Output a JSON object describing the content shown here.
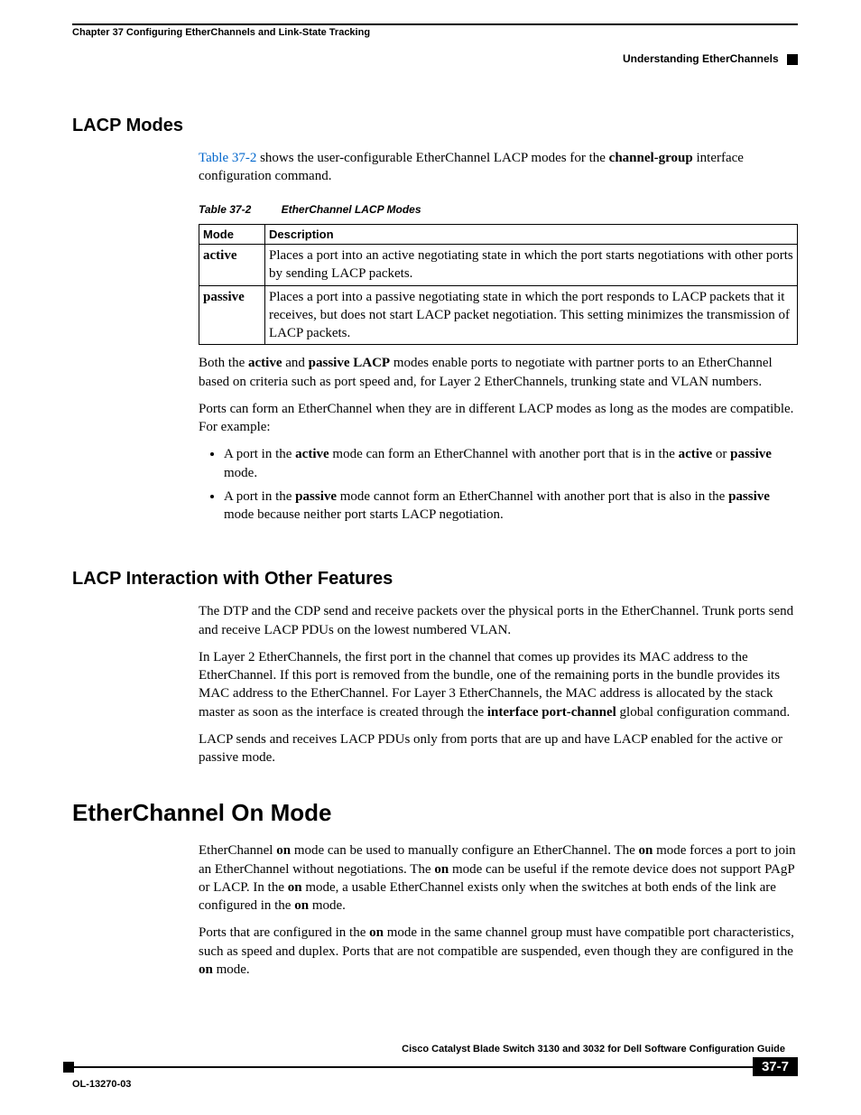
{
  "header": {
    "chapter": "Chapter 37      Configuring EtherChannels and Link-State Tracking",
    "section": "Understanding EtherChannels"
  },
  "s1": {
    "heading": "LACP Modes",
    "intro_link": "Table 37-2",
    "intro_a": " shows the user-configurable EtherChannel LACP modes for the ",
    "intro_b": "channel-group",
    "intro_c": " interface configuration command.",
    "table_caption_num": "Table 37-2",
    "table_caption_title": "EtherChannel LACP Modes",
    "th1": "Mode",
    "th2": "Description",
    "row1_mode": "active",
    "row1_desc": "Places a port into an active negotiating state in which the port starts negotiations with other ports by sending LACP packets.",
    "row2_mode": "passive",
    "row2_desc": "Places a port into a passive negotiating state in which the port responds to LACP packets that it receives, but does not start LACP packet negotiation. This setting minimizes the transmission of LACP packets.",
    "p2_a": "Both the ",
    "p2_b": "active",
    "p2_c": " and ",
    "p2_d": "passive LACP",
    "p2_e": " modes enable ports to negotiate with partner ports to an EtherChannel based on criteria such as port speed and, for Layer 2 EtherChannels, trunking state and VLAN numbers.",
    "p3": "Ports can form an EtherChannel when they are in different LACP modes as long as the modes are compatible. For example:",
    "b1_a": "A port in the ",
    "b1_b": "active",
    "b1_c": " mode can form an EtherChannel with another port that is in the ",
    "b1_d": "active",
    "b1_e": " or ",
    "b1_f": "passive",
    "b1_g": " mode.",
    "b2_a": "A port in the ",
    "b2_b": "passive",
    "b2_c": " mode cannot form an EtherChannel with another port that is also in the ",
    "b2_d": "passive",
    "b2_e": " mode because neither port starts LACP negotiation."
  },
  "s2": {
    "heading": "LACP Interaction with Other Features",
    "p1": "The DTP and the CDP send and receive packets over the physical ports in the EtherChannel. Trunk ports send and receive LACP PDUs on the lowest numbered VLAN.",
    "p2_a": "In Layer 2 EtherChannels, the first port in the channel that comes up provides its MAC address to the EtherChannel. If this port is removed from the bundle, one of the remaining ports in the bundle provides its MAC address to the EtherChannel. For Layer 3 EtherChannels, the MAC address is allocated by the stack master as soon as the interface is created through the ",
    "p2_b": "interface port-channel",
    "p2_c": " global configuration command.",
    "p3": "LACP sends and receives LACP PDUs only from ports that are up and have LACP enabled for the active or passive mode."
  },
  "s3": {
    "heading": "EtherChannel On Mode",
    "p1_a": "EtherChannel ",
    "p1_b": "on",
    "p1_c": " mode can be used to manually configure an EtherChannel. The ",
    "p1_d": "on",
    "p1_e": " mode forces a port to join an EtherChannel without negotiations. The ",
    "p1_f": "on",
    "p1_g": " mode can be useful if the remote device does not support PAgP or LACP. In the ",
    "p1_h": "on",
    "p1_i": " mode, a usable EtherChannel exists only when the switches at both ends of the link are configured in the ",
    "p1_j": "on",
    "p1_k": " mode.",
    "p2_a": "Ports that are configured in the ",
    "p2_b": "on",
    "p2_c": " mode in the same channel group must have compatible port characteristics, such as speed and duplex. Ports that are not compatible are suspended, even though they are configured in the ",
    "p2_d": "on",
    "p2_e": " mode."
  },
  "footer": {
    "title": "Cisco Catalyst Blade Switch 3130 and 3032 for Dell Software Configuration Guide",
    "page": "37-7",
    "docid": "OL-13270-03"
  }
}
